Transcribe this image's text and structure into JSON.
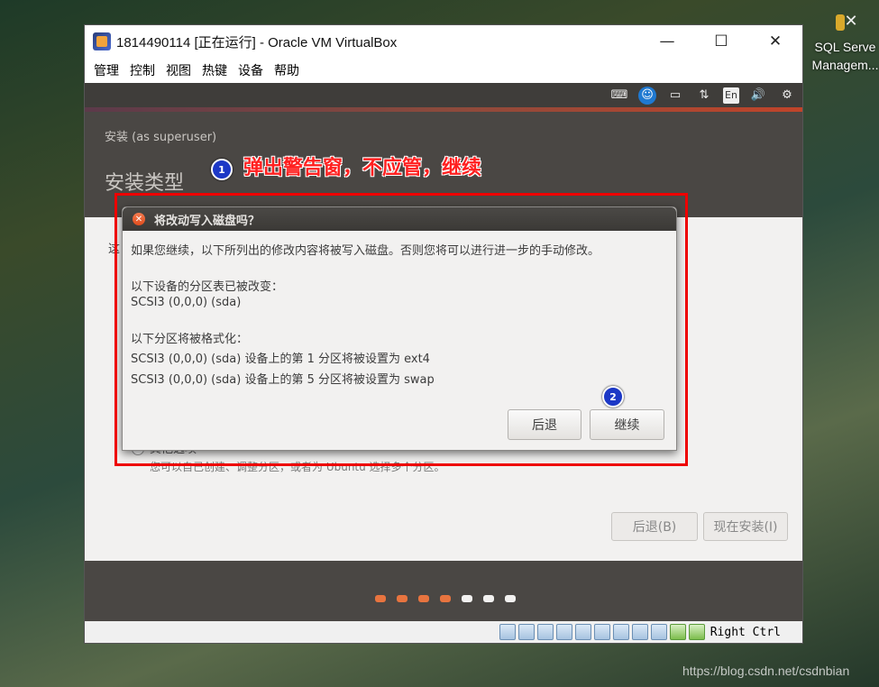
{
  "desktop": {
    "icon_label_line1": "SQL Serve",
    "icon_label_line2": "Managem...",
    "watermark": "https://blog.csdn.net/csdnbian"
  },
  "window": {
    "title": "1814490114 [正在运行] - Oracle VM VirtualBox",
    "menu": [
      "管理",
      "控制",
      "视图",
      "热键",
      "设备",
      "帮助"
    ]
  },
  "guest": {
    "header_subtitle": "安装 (as superuser)",
    "header_title": "安装类型",
    "content_fragment": "这",
    "option_label_fragment": "其他选项",
    "option_hint": "您可以自己创建、调整分区，或者为 Ubuntu 选择多个分区。",
    "back_button": "后退(B)",
    "install_button": "现在安装(I)",
    "progress_colors": [
      "#e8743f",
      "#e8743f",
      "#e8743f",
      "#e8743f",
      "#f2f1f0",
      "#f2f1f0",
      "#f2f1f0"
    ]
  },
  "dialog": {
    "title": "将改动写入磁盘吗？",
    "intro": "如果您继续，以下所列出的修改内容将被写入磁盘。否则您将可以进行进一步的手动修改。",
    "partition_table_heading": "以下设备的分区表已被改变：",
    "partition_table_device": "SCSI3 (0,0,0) (sda)",
    "format_heading": "以下分区将被格式化：",
    "format_item_1": "SCSI3 (0,0,0) (sda) 设备上的第 1 分区将被设置为 ext4",
    "format_item_2": "SCSI3 (0,0,0) (sda) 设备上的第 5 分区将被设置为 swap",
    "back_button": "后退",
    "continue_button": "继续"
  },
  "annotations": {
    "marker_1": "1",
    "marker_2": "2",
    "note": "弹出警告窗，不应管，继续"
  },
  "statusbar": {
    "host_key": "Right Ctrl",
    "lang_indicator": "En"
  }
}
